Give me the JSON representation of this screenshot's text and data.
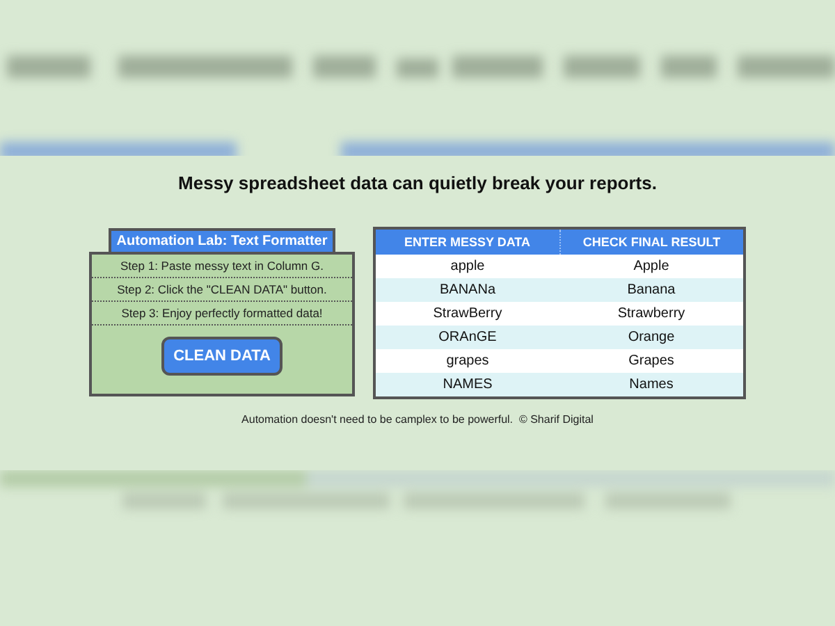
{
  "heading": "Messy spreadsheet data can quietly break your reports.",
  "panel": {
    "tab": "Automation Lab: Text Formatter",
    "steps": [
      "Step 1: Paste messy text in Column G.",
      "Step 2: Click the \"CLEAN DATA\" button.",
      "Step 3: Enjoy perfectly formatted data!"
    ],
    "button": "CLEAN DATA"
  },
  "table": {
    "columns": [
      "ENTER MESSY DATA",
      "CHECK FINAL RESULT"
    ],
    "rows": [
      [
        "apple",
        "Apple"
      ],
      [
        "BANANa",
        "Banana"
      ],
      [
        "StrawBerry",
        "Strawberry"
      ],
      [
        "ORAnGE",
        "Orange"
      ],
      [
        "grapes",
        "Grapes"
      ],
      [
        "NAMES",
        "Names"
      ]
    ]
  },
  "footer": "Automation doesn't need to be camplex to be powerful.  © Sharif Digital"
}
